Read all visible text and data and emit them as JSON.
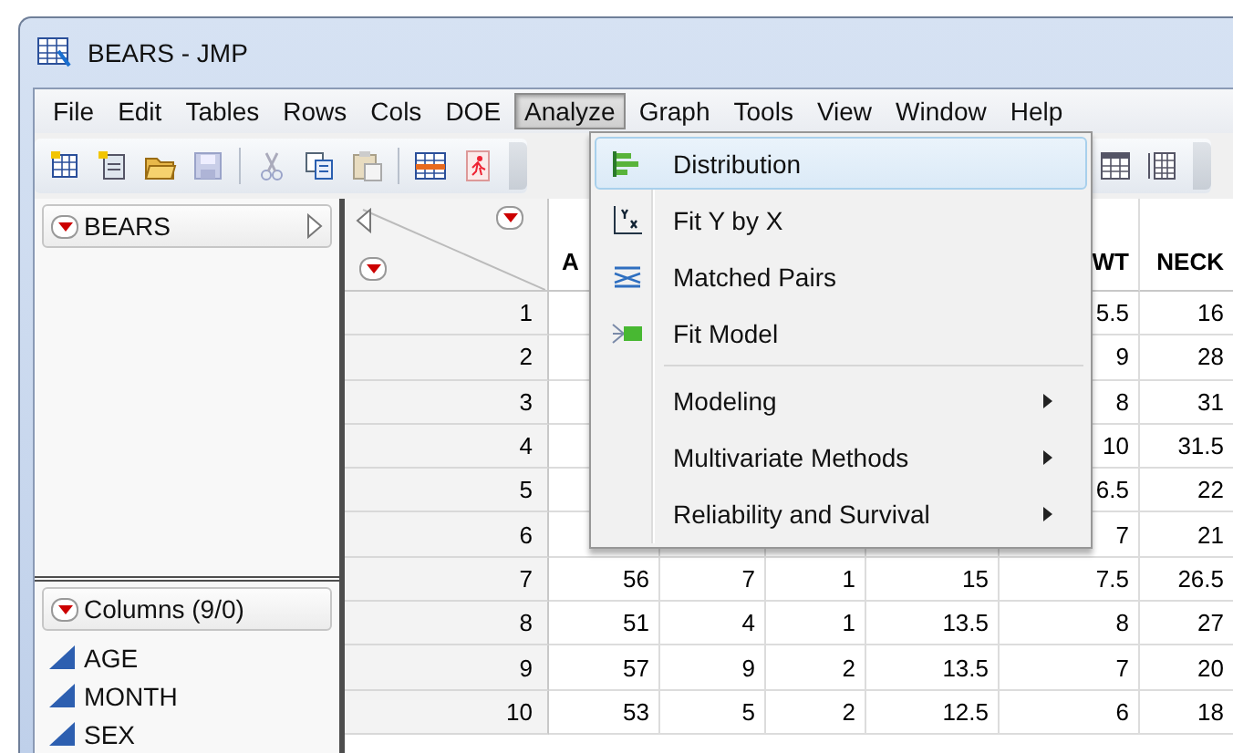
{
  "window": {
    "title": "BEARS - JMP"
  },
  "menu_bar": [
    {
      "label": "File",
      "selected": false
    },
    {
      "label": "Edit",
      "selected": false
    },
    {
      "label": "Tables",
      "selected": false
    },
    {
      "label": "Rows",
      "selected": false
    },
    {
      "label": "Cols",
      "selected": false
    },
    {
      "label": "DOE",
      "selected": false
    },
    {
      "label": "Analyze",
      "selected": true
    },
    {
      "label": "Graph",
      "selected": false
    },
    {
      "label": "Tools",
      "selected": false
    },
    {
      "label": "View",
      "selected": false
    },
    {
      "label": "Window",
      "selected": false
    },
    {
      "label": "Help",
      "selected": false
    }
  ],
  "table_panel": {
    "title": "BEARS"
  },
  "columns_panel": {
    "title": "Columns (9/0)",
    "columns": [
      "AGE",
      "MONTH",
      "SEX"
    ]
  },
  "table": {
    "columns": [
      "A",
      null,
      null,
      null,
      "WT",
      "NECK"
    ],
    "rows": [
      {
        "number": "1",
        "cells": [
          null,
          null,
          null,
          null,
          "5.5",
          "16"
        ]
      },
      {
        "number": "2",
        "cells": [
          null,
          null,
          null,
          null,
          "9",
          "28"
        ]
      },
      {
        "number": "3",
        "cells": [
          null,
          null,
          null,
          null,
          "8",
          "31"
        ]
      },
      {
        "number": "4",
        "cells": [
          null,
          null,
          null,
          null,
          "10",
          "31.5"
        ]
      },
      {
        "number": "5",
        "cells": [
          null,
          null,
          null,
          null,
          "6.5",
          "22"
        ]
      },
      {
        "number": "6",
        "cells": [
          null,
          null,
          null,
          null,
          "7",
          "21"
        ]
      },
      {
        "number": "7",
        "cells": [
          "56",
          "7",
          "1",
          "15",
          "7.5",
          "26.5"
        ]
      },
      {
        "number": "8",
        "cells": [
          "51",
          "4",
          "1",
          "13.5",
          "8",
          "27"
        ]
      },
      {
        "number": "9",
        "cells": [
          "57",
          "9",
          "2",
          "13.5",
          "7",
          "20"
        ]
      },
      {
        "number": "10",
        "cells": [
          "53",
          "5",
          "2",
          "12.5",
          "6",
          "18"
        ]
      }
    ]
  },
  "analyze_menu": {
    "items": [
      {
        "kind": "command",
        "label": "Distribution",
        "selected": true
      },
      {
        "kind": "command",
        "label": "Fit Y by X",
        "selected": false
      },
      {
        "kind": "command",
        "label": "Matched Pairs",
        "selected": false
      },
      {
        "kind": "command",
        "label": "Fit Model",
        "selected": false
      },
      {
        "kind": "separator"
      },
      {
        "kind": "submenu",
        "label": "Modeling",
        "selected": false
      },
      {
        "kind": "submenu",
        "label": "Multivariate Methods",
        "selected": false
      },
      {
        "kind": "submenu",
        "label": "Reliability and Survival",
        "selected": false
      }
    ]
  }
}
